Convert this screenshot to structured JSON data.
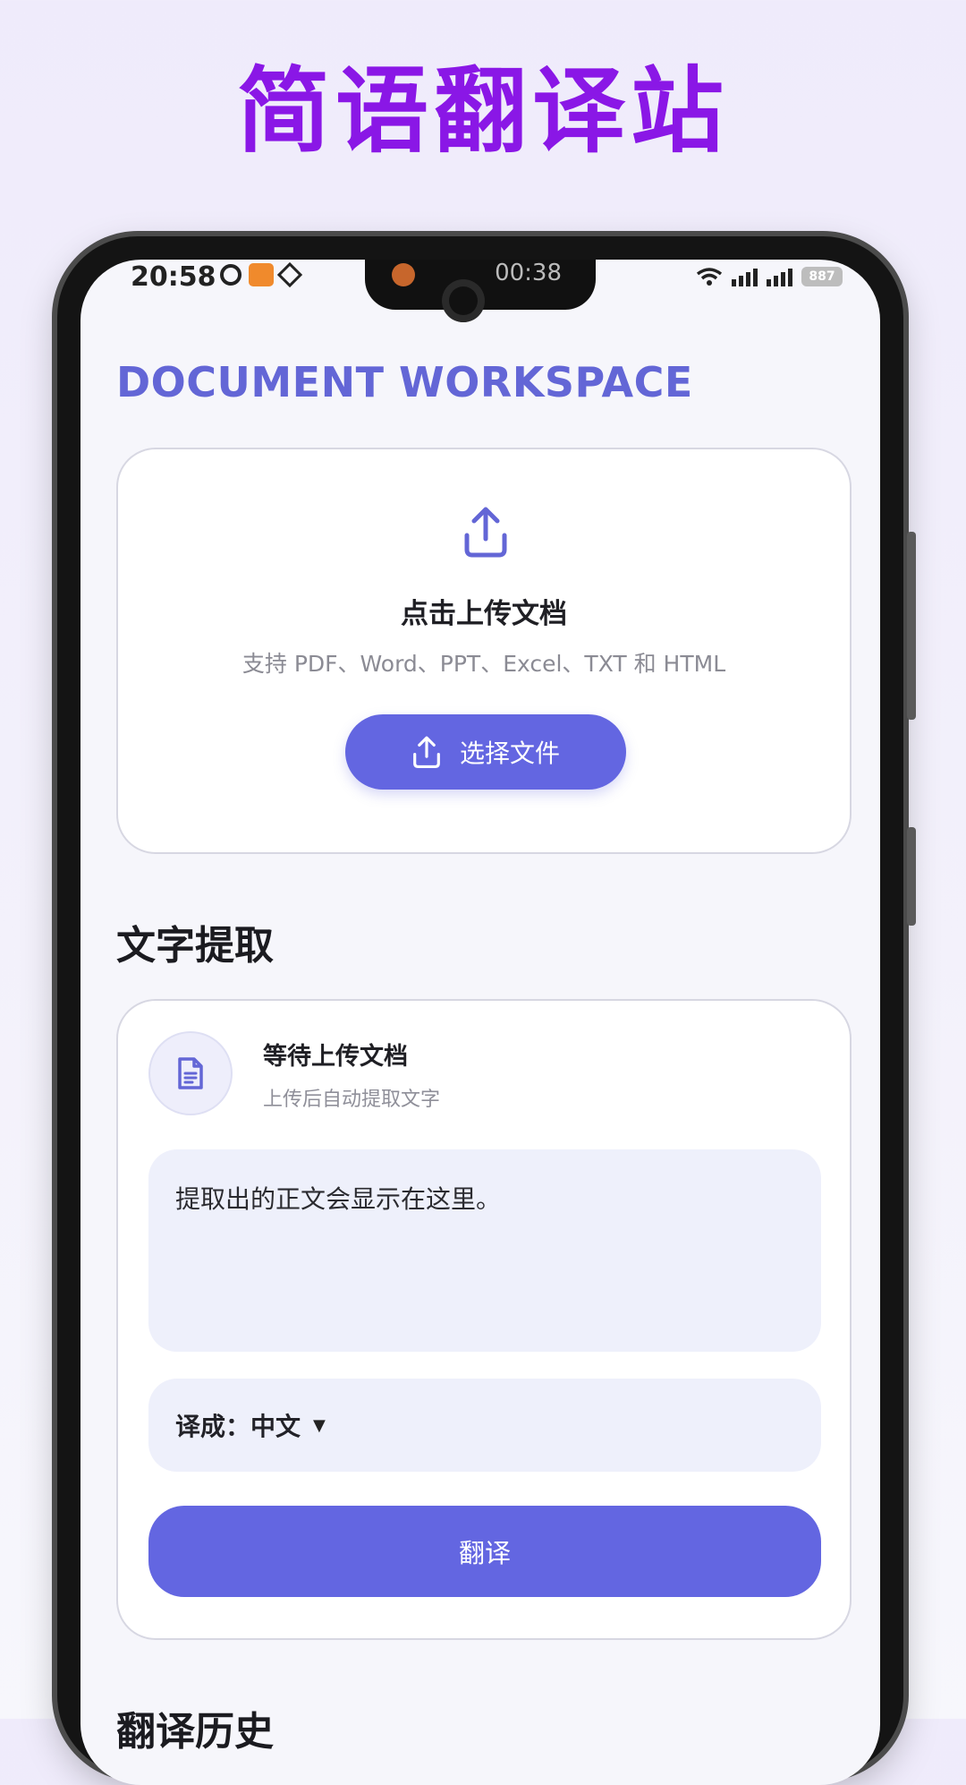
{
  "promo": {
    "title": "简语翻译站"
  },
  "status_bar": {
    "time": "20:58",
    "notch_time": "00:38",
    "battery": "887"
  },
  "app": {
    "title": "DOCUMENT WORKSPACE"
  },
  "upload": {
    "heading": "点击上传文档",
    "supported_formats": "支持 PDF、Word、PPT、Excel、TXT 和 HTML",
    "button_label": "选择文件",
    "icon": "upload-icon"
  },
  "extraction": {
    "section_title": "文字提取",
    "status_title": "等待上传文档",
    "status_subtitle": "上传后自动提取文字",
    "text_placeholder": "提取出的正文会显示在这里。",
    "icon": "document-icon",
    "translate_to_label": "译成：",
    "translate_to_value": "中文",
    "translate_button": "翻译"
  },
  "history": {
    "section_title": "翻译历史"
  },
  "colors": {
    "accent": "#6366e1",
    "promo_title": "#8a17e6",
    "app_title": "#6366d6",
    "field_bg": "#eef0fb"
  }
}
